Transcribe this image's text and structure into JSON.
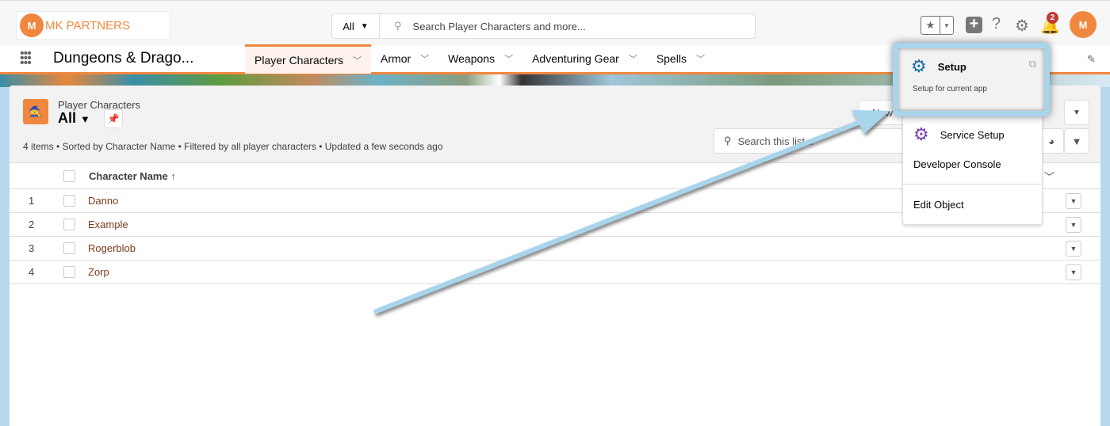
{
  "header": {
    "logo_text": "MK PARTNERS",
    "search_scope": "All",
    "search_placeholder": "Search Player Characters and more...",
    "notification_count": "2",
    "help": "?"
  },
  "nav": {
    "app_name": "Dungeons & Drago...",
    "tabs": [
      {
        "label": "Player Characters",
        "active": true
      },
      {
        "label": "Armor"
      },
      {
        "label": "Weapons"
      },
      {
        "label": "Adventuring Gear"
      },
      {
        "label": "Spells"
      }
    ]
  },
  "list": {
    "object_label": "Player Characters",
    "view_name": "All",
    "info": "4 items • Sorted by Character Name • Filtered by all player characters • Updated a few seconds ago",
    "new_button": "New",
    "search_placeholder": "Search this list...",
    "column": "Character Name",
    "sort_icon": "↑",
    "rows": [
      {
        "num": "1",
        "name": "Danno"
      },
      {
        "num": "2",
        "name": "Example"
      },
      {
        "num": "3",
        "name": "Rogerblob"
      },
      {
        "num": "4",
        "name": "Zorp"
      }
    ]
  },
  "setup_menu": {
    "setup": "Setup",
    "setup_sub": "Setup for current app",
    "service_setup": "Service Setup",
    "developer_console": "Developer Console",
    "edit_object": "Edit Object"
  },
  "colors": {
    "brand": "#f0873f",
    "setup_gear": "#1b6ea8",
    "service_gear": "#7b3fb8",
    "link": "#7a3b1b",
    "highlight": "#a8d4ec"
  }
}
